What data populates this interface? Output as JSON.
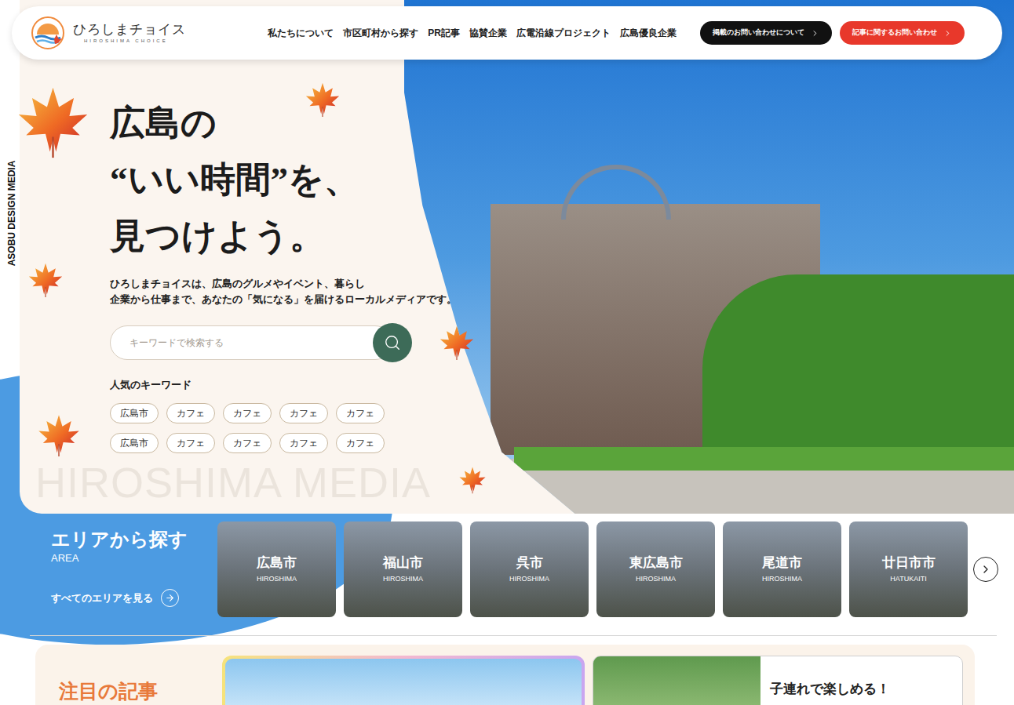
{
  "side_label": "ASOBU DESIGN MEDIA",
  "header": {
    "logo": {
      "name": "ひろしまチョイス",
      "sub": "HIROSHIMA CHOICE"
    },
    "nav": [
      "私たちについて",
      "市区町村から探す",
      "PR記事",
      "協賛企業",
      "広電沿線プロジェクト",
      "広島優良企業"
    ],
    "buttons": [
      {
        "label": "掲載のお問い合わせについて",
        "color": "#111111"
      },
      {
        "label": "記事に関するお問い合わせ",
        "color": "#e8382b"
      }
    ]
  },
  "hero": {
    "title_lines": [
      "広島の",
      "“いい時間”を、",
      "見つけよう。"
    ],
    "description_lines": [
      "ひろしまチョイスは、広島のグルメやイベント、暮らし",
      "企業から仕事まで、あなたの「気になる」を届けるローカルメディアです。"
    ],
    "search": {
      "placeholder": "キーワードで検索する"
    },
    "keywords_label": "人気のキーワード",
    "keywords": [
      "広島市",
      "カフェ",
      "カフェ",
      "カフェ",
      "カフェ",
      "広島市",
      "カフェ",
      "カフェ",
      "カフェ",
      "カフェ"
    ],
    "watermark": "HIROSHIMA MEDIA"
  },
  "area": {
    "title": "エリアから探す",
    "sub": "AREA",
    "link": "すべてのエリアを見る",
    "cities": [
      {
        "name": "広島市",
        "roman": "HIROSHIMA"
      },
      {
        "name": "福山市",
        "roman": "HIROSHIMA"
      },
      {
        "name": "呉市",
        "roman": "HIROSHIMA"
      },
      {
        "name": "東広島市",
        "roman": "HIROSHIMA"
      },
      {
        "name": "尾道市",
        "roman": "HIROSHIMA"
      },
      {
        "name": "廿日市市",
        "roman": "HATUKAITI"
      }
    ]
  },
  "featured": {
    "title": "注目の記事",
    "side_card_title": "子連れで楽しめる！"
  }
}
